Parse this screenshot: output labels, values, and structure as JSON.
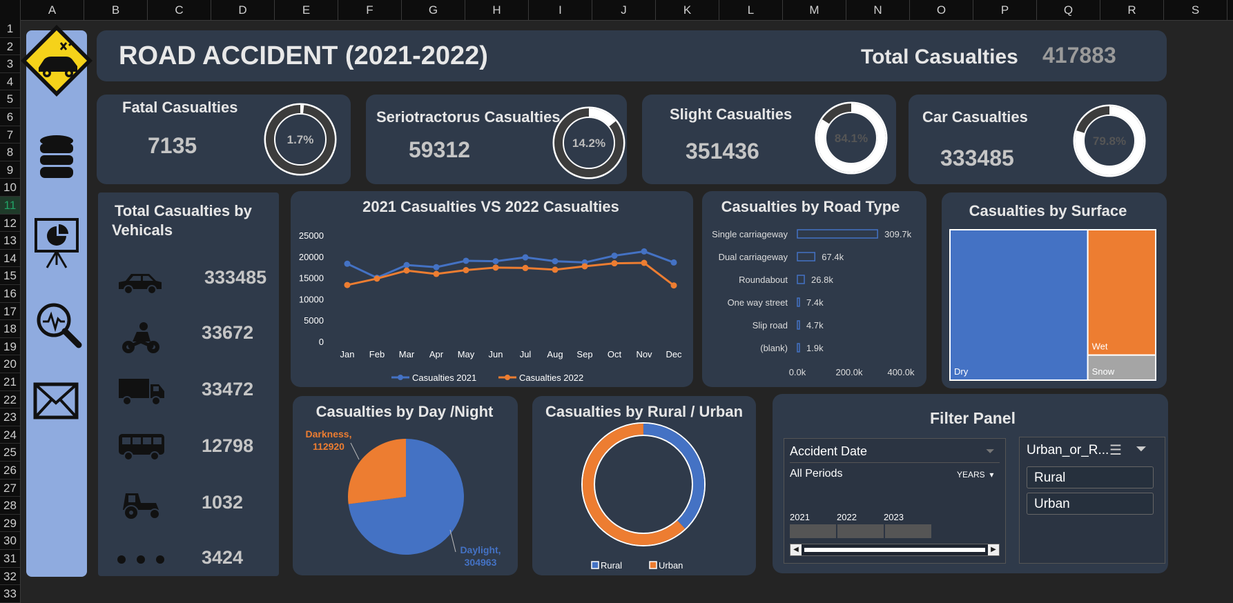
{
  "spreadsheet": {
    "columns": [
      "A",
      "B",
      "C",
      "D",
      "E",
      "F",
      "G",
      "H",
      "I",
      "J",
      "K",
      "L",
      "M",
      "N",
      "O",
      "P",
      "Q",
      "R",
      "S"
    ],
    "rows": [
      "1",
      "2",
      "3",
      "4",
      "5",
      "6",
      "7",
      "8",
      "9",
      "10",
      "11",
      "12",
      "13",
      "14",
      "15",
      "16",
      "17",
      "18",
      "19",
      "20",
      "21",
      "22",
      "23",
      "24",
      "25",
      "26",
      "27",
      "28",
      "29",
      "30",
      "31",
      "32",
      "33"
    ],
    "selected_row": "11"
  },
  "header": {
    "title": "ROAD ACCIDENT (2021-2022)",
    "total_label": "Total Casualties",
    "total_value": "417883"
  },
  "kpis": [
    {
      "label": "Fatal Casualties",
      "value": "7135",
      "pct_label": "1.7%",
      "pct": 1.7
    },
    {
      "label": "Seriotractorus Casualties",
      "value": "59312",
      "pct_label": "14.2%",
      "pct": 14.2
    },
    {
      "label": "Slight Casualties",
      "value": "351436",
      "pct_label": "84.1%",
      "pct": 84.1
    },
    {
      "label": "Car Casualties",
      "value": "333485",
      "pct_label": "79.8%",
      "pct": 79.8
    }
  ],
  "vehicles": {
    "title_line1": "Total Casualties by",
    "title_line2": "Vehicals",
    "items": [
      {
        "icon": "car-icon",
        "value": "333485"
      },
      {
        "icon": "motorcycle-icon",
        "value": "33672"
      },
      {
        "icon": "truck-icon",
        "value": "33472"
      },
      {
        "icon": "bus-icon",
        "value": "12798"
      },
      {
        "icon": "tractor-icon",
        "value": "1032"
      },
      {
        "icon": "more-icon",
        "value": "3424"
      }
    ]
  },
  "sidebar": {
    "icons": [
      "database-icon",
      "presentation-icon",
      "search-analytics-icon",
      "mail-icon"
    ]
  },
  "filter": {
    "title": "Filter Panel",
    "date_slicer": {
      "title": "Accident Date",
      "periods": "All Periods",
      "unit": "YEARS",
      "years": [
        "2021",
        "2022",
        "2023"
      ]
    },
    "area_slicer": {
      "title": "Urban_or_R...",
      "options": [
        "Rural",
        "Urban"
      ]
    }
  },
  "colors": {
    "blue": "#4472c4",
    "orange": "#ed7d31",
    "gray": "#a5a5a5",
    "panel": "#2f3a4a"
  },
  "chart_data": [
    {
      "type": "line",
      "title": "2021 Casualties   VS  2022 Casualties",
      "categories": [
        "Jan",
        "Feb",
        "Mar",
        "Apr",
        "May",
        "Jun",
        "Jul",
        "Aug",
        "Sep",
        "Oct",
        "Nov",
        "Dec"
      ],
      "series": [
        {
          "name": "Casualties 2021",
          "values": [
            18300,
            15000,
            18000,
            17500,
            19000,
            18900,
            19800,
            18900,
            18600,
            20200,
            21200,
            18600
          ]
        },
        {
          "name": "Casualties 2022",
          "values": [
            13300,
            14800,
            16700,
            15900,
            16800,
            17400,
            17300,
            16900,
            17700,
            18400,
            18500,
            13200
          ]
        }
      ],
      "yticks": [
        "0",
        "5000",
        "10000",
        "15000",
        "20000",
        "25000"
      ],
      "ylim": [
        0,
        25000
      ]
    },
    {
      "type": "bar",
      "title": "Casualties by Road Type",
      "categories": [
        "Single carriageway",
        "Dual carriageway",
        "Roundabout",
        "One way street",
        "Slip road",
        "(blank)"
      ],
      "values": [
        309700,
        67400,
        26800,
        7400,
        4700,
        1900
      ],
      "data_labels": [
        "309.7k",
        "67.4k",
        "26.8k",
        "7.4k",
        "4.7k",
        "1.9k"
      ],
      "xticks": [
        "0.0k",
        "200.0k",
        "400.0k"
      ],
      "xlim": [
        0,
        400000
      ]
    },
    {
      "type": "treemap",
      "title": "Casualties by Surface",
      "categories": [
        "Dry",
        "Wet",
        "Snow"
      ],
      "values": [
        280000,
        115000,
        23000
      ]
    },
    {
      "type": "pie",
      "title": "Casualties by Day /Night",
      "categories": [
        "Daylight",
        "Darkness"
      ],
      "values": [
        304963,
        112920
      ],
      "labels": [
        {
          "name": "Daylight,",
          "value": "304963"
        },
        {
          "name": "Darkness,",
          "value": "112920"
        }
      ]
    },
    {
      "type": "pie",
      "title": "Casualties by Rural / Urban",
      "categories": [
        "Rural",
        "Urban"
      ],
      "values": [
        38,
        62
      ],
      "legend": [
        "Rural",
        "Urban"
      ]
    }
  ]
}
